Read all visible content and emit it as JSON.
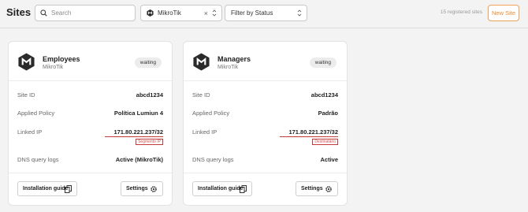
{
  "header": {
    "title": "Sites",
    "search_placeholder": "Search",
    "vendor_filter": {
      "selected": "MikroTik",
      "clear": "×"
    },
    "status_filter": {
      "selected": "Filter by Status"
    },
    "registered_count": "15 registered sites",
    "new_site_label": "New Site"
  },
  "colors": {
    "accent": "#ef8a2e",
    "annotation": "#c33a3a"
  },
  "cards": [
    {
      "name": "Employees",
      "vendor": "MikroTik",
      "status": "waiting",
      "rows": [
        {
          "label": "Site ID",
          "value": "abcd1234"
        },
        {
          "label": "Applied Policy",
          "value": "Política Lumiun 4"
        },
        {
          "label": "Linked IP",
          "value": "171.80.221.237/32",
          "note": "Segmento IP"
        },
        {
          "label": "DNS query logs",
          "value": "Active (MikroTik)"
        }
      ],
      "guide_label": "Installation guide",
      "settings_label": "Settings"
    },
    {
      "name": "Managers",
      "vendor": "MikroTik",
      "status": "waiting",
      "rows": [
        {
          "label": "Site ID",
          "value": "abcd1234"
        },
        {
          "label": "Applied Policy",
          "value": "Padrão"
        },
        {
          "label": "Linked IP",
          "value": "171.80.221.237/32",
          "note": "Destinatário"
        },
        {
          "label": "DNS query logs",
          "value": "Active"
        }
      ],
      "guide_label": "Installation guide",
      "settings_label": "Settings"
    }
  ]
}
